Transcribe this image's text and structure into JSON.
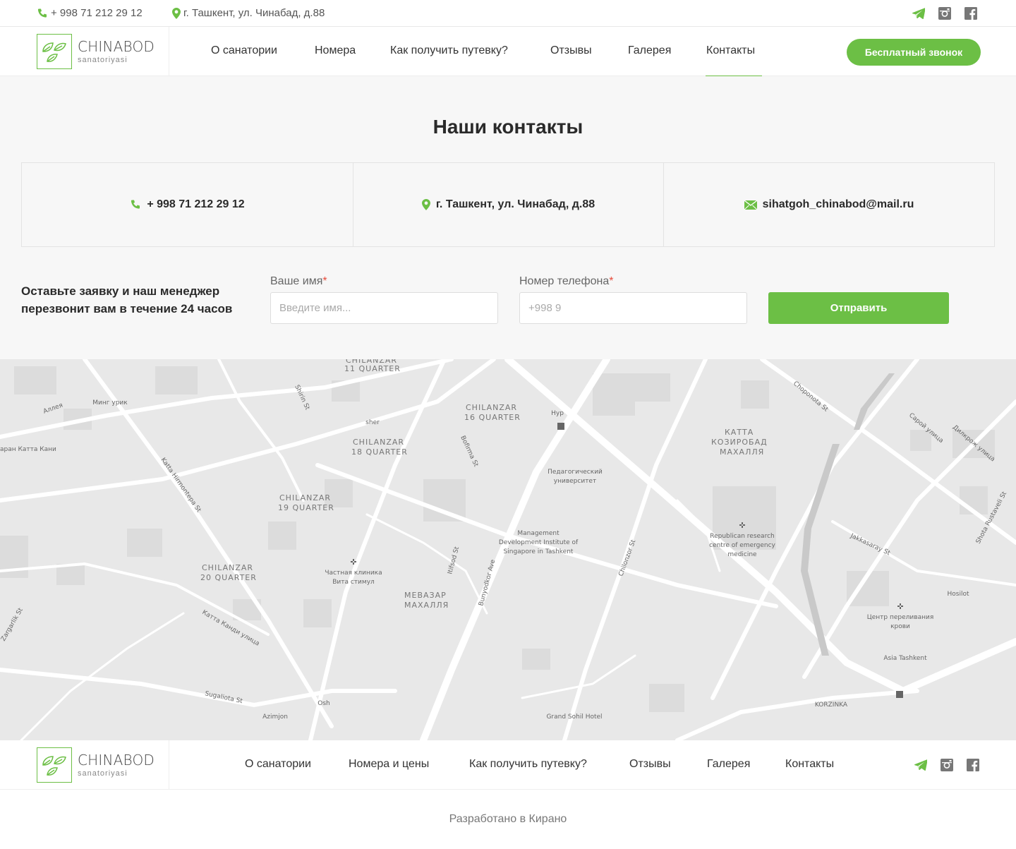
{
  "topbar": {
    "phone": "+ 998 71 212 29 12",
    "address": "г. Ташкент, ул. Чинабад, д.88",
    "social": [
      "telegram-icon",
      "instagram-icon",
      "facebook-icon"
    ]
  },
  "brand": {
    "name": "CHINABOD",
    "sub": "sanatoriyasi",
    "color": "#6cbf45"
  },
  "nav": {
    "items": [
      "О санатории",
      "Номера",
      "Как получить путевку?",
      "Отзывы",
      "Галерея",
      "Контакты"
    ],
    "active": "Контакты",
    "cta": "Бесплатный звонок"
  },
  "contacts": {
    "title": "Наши контакты",
    "phone": "+ 998 71 212 29 12",
    "address": "г. Ташкент, ул. Чинабад, д.88",
    "email": "sihatgoh_chinabod@mail.ru"
  },
  "form": {
    "text": "Оставьте заявку и наш менеджер перезвонит вам в течение 24 часов",
    "name_label": "Ваше имя",
    "name_placeholder": "Введите имя...",
    "phone_label": "Номер телефона",
    "phone_placeholder": "+998 9",
    "required_mark": "*",
    "submit": "Отправить"
  },
  "map": {
    "labels": [
      "CHILANZAR",
      "11 QUARTER",
      "CHILANZAR",
      "16 QUARTER",
      "CHILANZAR",
      "18 QUARTER",
      "CHILANZAR",
      "19 QUARTER",
      "CHILANZAR",
      "20 QUARTER",
      "КАТТА",
      "КОЗИРОБАД",
      "МАХАЛЛЯ",
      "МЕВАЗАР",
      "МАХАЛЛЯ",
      "Минг урик",
      "Аллея",
      "sher",
      "Hyp",
      "Педагогический",
      "университет",
      "Management",
      "Development Institute of",
      "Singapore in Tashkent",
      "Частная клиника",
      "Вита стимул",
      "Republican research",
      "centre of emergency",
      "medicine",
      "Центр переливания",
      "крови",
      "Asia Tashkent",
      "Hosilot",
      "KORZINKA",
      "Grand Sohil Hotel",
      "Azimjon",
      "Osh",
      "Shirin St",
      "Bofirma St",
      "Katta Hirmontepa St",
      "Itifsod St",
      "Bunyodkor Ave",
      "Chilonzor St",
      "Choponota St",
      "Сарой улица",
      "Дилкрож улица",
      "Jakkasaray St",
      "Shota Rustaveli St",
      "Zargarlik St",
      "Катта Канди улица",
      "Sugaliota St",
      "аран Катта Кани"
    ]
  },
  "footer": {
    "nav": [
      "О санатории",
      "Номера и цены",
      "Как получить путевку?",
      "Отзывы",
      "Галерея",
      "Контакты"
    ],
    "copyright": "Разработано в Кирано"
  }
}
